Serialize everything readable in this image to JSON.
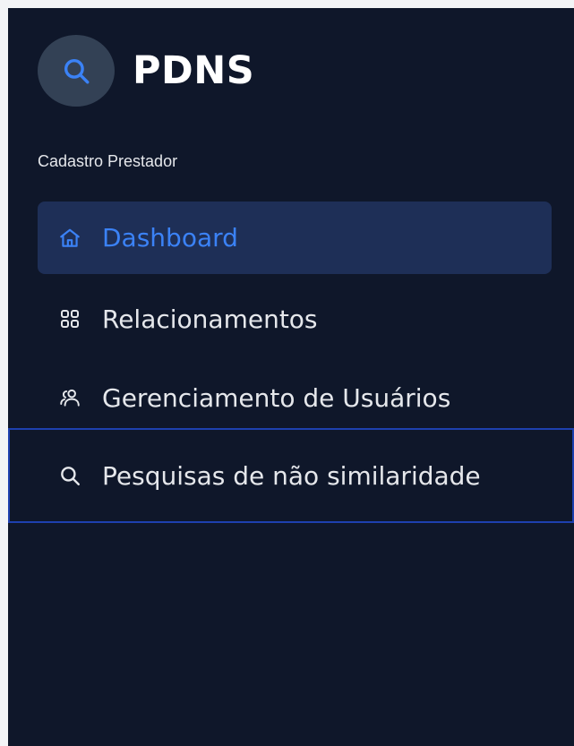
{
  "app": {
    "brand_title": "PDNS",
    "brand_icon": "search-icon"
  },
  "sidebar": {
    "section_label": "Cadastro Prestador",
    "items": [
      {
        "label": "Dashboard",
        "icon": "home-icon",
        "active": true
      },
      {
        "label": "Relacionamentos",
        "icon": "grid-icon",
        "active": false
      },
      {
        "label": "Gerenciamento de Usuários",
        "icon": "users-icon",
        "active": false
      },
      {
        "label": "Pesquisas de não similaridade",
        "icon": "search-icon",
        "active": false,
        "focused": true
      }
    ]
  },
  "colors": {
    "sidebar_bg": "#0f172a",
    "active_bg": "#1e2f57",
    "accent": "#3b82f6",
    "focus_border": "#1e40af",
    "text": "#e5e7eb"
  }
}
